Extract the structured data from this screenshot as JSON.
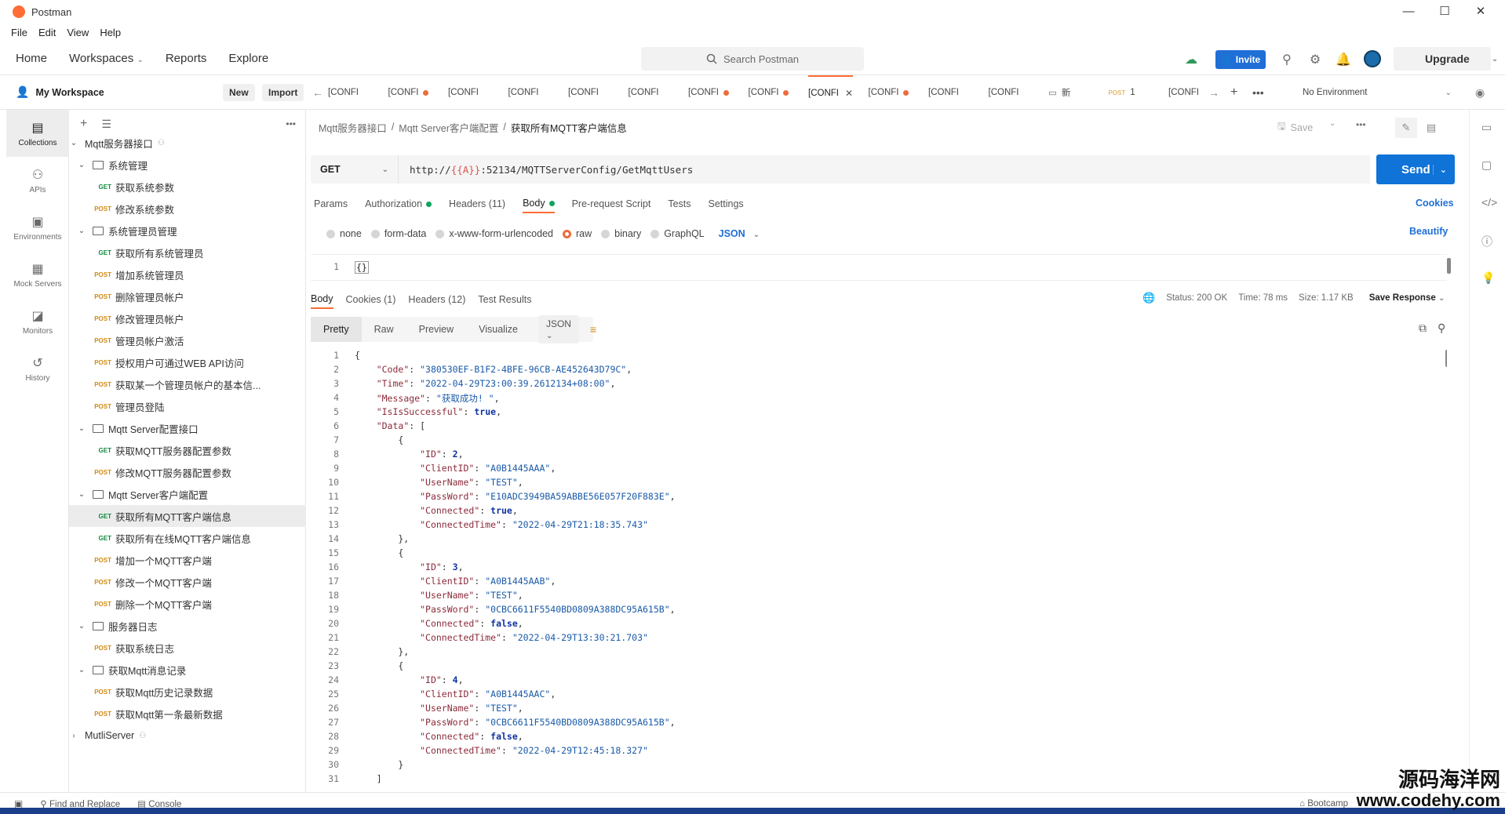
{
  "window": {
    "title": "Postman",
    "minimize": "—",
    "maximize": "☐",
    "close": "✕"
  },
  "menu": [
    "File",
    "Edit",
    "View",
    "Help"
  ],
  "header": {
    "nav": [
      "Home",
      "Workspaces",
      "Reports",
      "Explore"
    ],
    "search_placeholder": "Search Postman",
    "invite": "Invite",
    "upgrade": "Upgrade"
  },
  "workspace": {
    "name": "My Workspace",
    "new": "New",
    "import": "Import"
  },
  "iconbar": [
    {
      "label": "Collections",
      "icon": "collections-icon"
    },
    {
      "label": "APIs",
      "icon": "apis-icon"
    },
    {
      "label": "Environments",
      "icon": "environments-icon"
    },
    {
      "label": "Mock Servers",
      "icon": "mock-servers-icon"
    },
    {
      "label": "Monitors",
      "icon": "monitors-icon"
    },
    {
      "label": "History",
      "icon": "history-icon"
    }
  ],
  "tree": [
    {
      "type": "collection",
      "depth": 0,
      "label": "Mqtt服务器接口",
      "expanded": true
    },
    {
      "type": "folder",
      "depth": 1,
      "label": "系统管理"
    },
    {
      "type": "request",
      "depth": 2,
      "method": "GET",
      "label": "获取系统参数"
    },
    {
      "type": "request",
      "depth": 2,
      "method": "POST",
      "label": "修改系统参数"
    },
    {
      "type": "folder",
      "depth": 1,
      "label": "系统管理员管理"
    },
    {
      "type": "request",
      "depth": 2,
      "method": "GET",
      "label": "获取所有系统管理员"
    },
    {
      "type": "request",
      "depth": 2,
      "method": "POST",
      "label": "增加系统管理员"
    },
    {
      "type": "request",
      "depth": 2,
      "method": "POST",
      "label": "删除管理员帐户"
    },
    {
      "type": "request",
      "depth": 2,
      "method": "POST",
      "label": "修改管理员帐户"
    },
    {
      "type": "request",
      "depth": 2,
      "method": "POST",
      "label": "管理员帐户激活"
    },
    {
      "type": "request",
      "depth": 2,
      "method": "POST",
      "label": "授权用户可通过WEB API访问"
    },
    {
      "type": "request",
      "depth": 2,
      "method": "POST",
      "label": "获取某一个管理员帐户的基本信..."
    },
    {
      "type": "request",
      "depth": 2,
      "method": "POST",
      "label": "管理员登陆"
    },
    {
      "type": "folder",
      "depth": 1,
      "label": "Mqtt Server配置接口"
    },
    {
      "type": "request",
      "depth": 2,
      "method": "GET",
      "label": "获取MQTT服务器配置参数"
    },
    {
      "type": "request",
      "depth": 2,
      "method": "POST",
      "label": "修改MQTT服务器配置参数"
    },
    {
      "type": "folder",
      "depth": 1,
      "label": "Mqtt Server客户端配置"
    },
    {
      "type": "request",
      "depth": 2,
      "method": "GET",
      "label": "获取所有MQTT客户端信息",
      "selected": true
    },
    {
      "type": "request",
      "depth": 2,
      "method": "GET",
      "label": "获取所有在线MQTT客户端信息"
    },
    {
      "type": "request",
      "depth": 2,
      "method": "POST",
      "label": "增加一个MQTT客户端"
    },
    {
      "type": "request",
      "depth": 2,
      "method": "POST",
      "label": "修改一个MQTT客户端"
    },
    {
      "type": "request",
      "depth": 2,
      "method": "POST",
      "label": "删除一个MQTT客户端"
    },
    {
      "type": "folder",
      "depth": 1,
      "label": "服务器日志"
    },
    {
      "type": "request",
      "depth": 2,
      "method": "POST",
      "label": "获取系统日志"
    },
    {
      "type": "folder",
      "depth": 1,
      "label": "获取Mqtt消息记录"
    },
    {
      "type": "request",
      "depth": 2,
      "method": "POST",
      "label": "获取Mqtt历史记录数据"
    },
    {
      "type": "request",
      "depth": 2,
      "method": "POST",
      "label": "获取Mqtt第一条最新数据"
    },
    {
      "type": "collection",
      "depth": 0,
      "label": "MutliServer",
      "expanded": false
    }
  ],
  "tabs": [
    {
      "label": "[CONFI",
      "dot": false
    },
    {
      "label": "[CONFI",
      "dot": true
    },
    {
      "label": "[CONFI",
      "dot": false
    },
    {
      "label": "[CONFI",
      "dot": false
    },
    {
      "label": "[CONFI",
      "dot": false
    },
    {
      "label": "[CONFI",
      "dot": false
    },
    {
      "label": "[CONFI",
      "dot": true
    },
    {
      "label": "[CONFI",
      "dot": true
    },
    {
      "label": "[CONFI",
      "dot": false,
      "active": true
    },
    {
      "label": "[CONFI",
      "dot": true
    },
    {
      "label": "[CONFI",
      "dot": false
    },
    {
      "label": "[CONFI",
      "dot": false
    },
    {
      "label": "新",
      "dot": false,
      "folder": true
    },
    {
      "label": "1",
      "dot": false,
      "method": "POST"
    },
    {
      "label": "[CONFI",
      "dot": false
    }
  ],
  "environment": "No Environment",
  "breadcrumb": [
    "Mqtt服务器接口",
    "Mqtt Server客户端配置",
    "获取所有MQTT客户端信息"
  ],
  "request": {
    "save": "Save",
    "method": "GET",
    "url_prefix": "http://",
    "url_var": "{{A}}",
    "url_rest": ":52134/MQTTServerConfig/GetMqttUsers",
    "send": "Send",
    "tabs": [
      {
        "label": "Params",
        "dot": false
      },
      {
        "label": "Authorization",
        "dot": true
      },
      {
        "label": "Headers (11)",
        "dot": false
      },
      {
        "label": "Body",
        "dot": true,
        "active": true
      },
      {
        "label": "Pre-request Script",
        "dot": false
      },
      {
        "label": "Tests",
        "dot": false
      },
      {
        "label": "Settings",
        "dot": false
      }
    ],
    "cookies": "Cookies",
    "body_types": [
      "none",
      "form-data",
      "x-www-form-urlencoded",
      "raw",
      "binary",
      "GraphQL"
    ],
    "body_type_selected": "raw",
    "format": "JSON",
    "beautify": "Beautify",
    "editor_line": "1",
    "editor_text": "{}"
  },
  "response": {
    "tabs": [
      "Body",
      "Cookies (1)",
      "Headers (12)",
      "Test Results"
    ],
    "status": "Status: 200  OK",
    "time": "Time: 78 ms",
    "size": "Size: 1.17 KB",
    "save_response": "Save Response",
    "views": [
      "Pretty",
      "Raw",
      "Preview",
      "Visualize"
    ],
    "format": "JSON",
    "lines": [
      "{",
      "    \"Code\": \"380530EF-B1F2-4BFE-96CB-AE452643D79C\",",
      "    \"Time\": \"2022-04-29T23:00:39.2612134+08:00\",",
      "    \"Message\": \"获取成功! \",",
      "    \"IsIsSuccessful\": true,",
      "    \"Data\": [",
      "        {",
      "            \"ID\": 2,",
      "            \"ClientID\": \"A0B1445AAA\",",
      "            \"UserName\": \"TEST\",",
      "            \"PassWord\": \"E10ADC3949BA59ABBE56E057F20F883E\",",
      "            \"Connected\": true,",
      "            \"ConnectedTime\": \"2022-04-29T21:18:35.743\"",
      "        },",
      "        {",
      "            \"ID\": 3,",
      "            \"ClientID\": \"A0B1445AAB\",",
      "            \"UserName\": \"TEST\",",
      "            \"PassWord\": \"0CBC6611F5540BD0809A388DC95A615B\",",
      "            \"Connected\": false,",
      "            \"ConnectedTime\": \"2022-04-29T13:30:21.703\"",
      "        },",
      "        {",
      "            \"ID\": 4,",
      "            \"ClientID\": \"A0B1445AAC\",",
      "            \"UserName\": \"TEST\",",
      "            \"PassWord\": \"0CBC6611F5540BD0809A388DC95A615B\",",
      "            \"Connected\": false,",
      "            \"ConnectedTime\": \"2022-04-29T12:45:18.327\"",
      "        }",
      "    ]"
    ]
  },
  "footer": {
    "find_replace": "Find and Replace",
    "console": "Console",
    "bootcamp": "Bootcamp"
  },
  "watermark": {
    "line1": "源码海洋网",
    "line2": "www.codehy.com"
  },
  "colors": {
    "accent": "#ff6c37",
    "send": "#0f73d8",
    "invite": "#1f6fd6",
    "get": "#0f8a3c",
    "post": "#d38b12"
  }
}
